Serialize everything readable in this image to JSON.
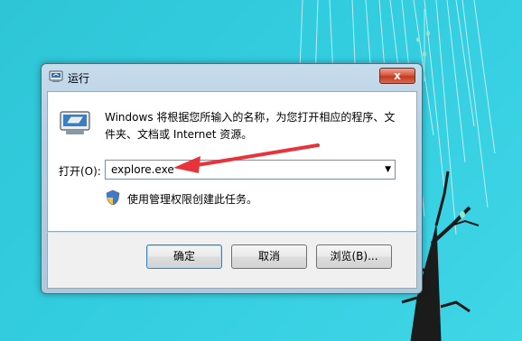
{
  "dialog": {
    "title": "运行",
    "close_glyph": "x",
    "description": "Windows 将根据您所输入的名称，为您打开相应的程序、文件夹、文档或 Internet 资源。",
    "open_label": "打开(O):",
    "open_value": "explore.exe",
    "admin_note": "使用管理权限创建此任务。",
    "buttons": {
      "ok": "确定",
      "cancel": "取消",
      "browse": "浏览(B)..."
    }
  },
  "icons": {
    "title": "run-icon",
    "main": "run-icon",
    "shield": "uac-shield-icon",
    "dropdown": "chevron-down-icon"
  },
  "colors": {
    "desktop": "#33cde0",
    "annotation_arrow": "#e8333a"
  }
}
